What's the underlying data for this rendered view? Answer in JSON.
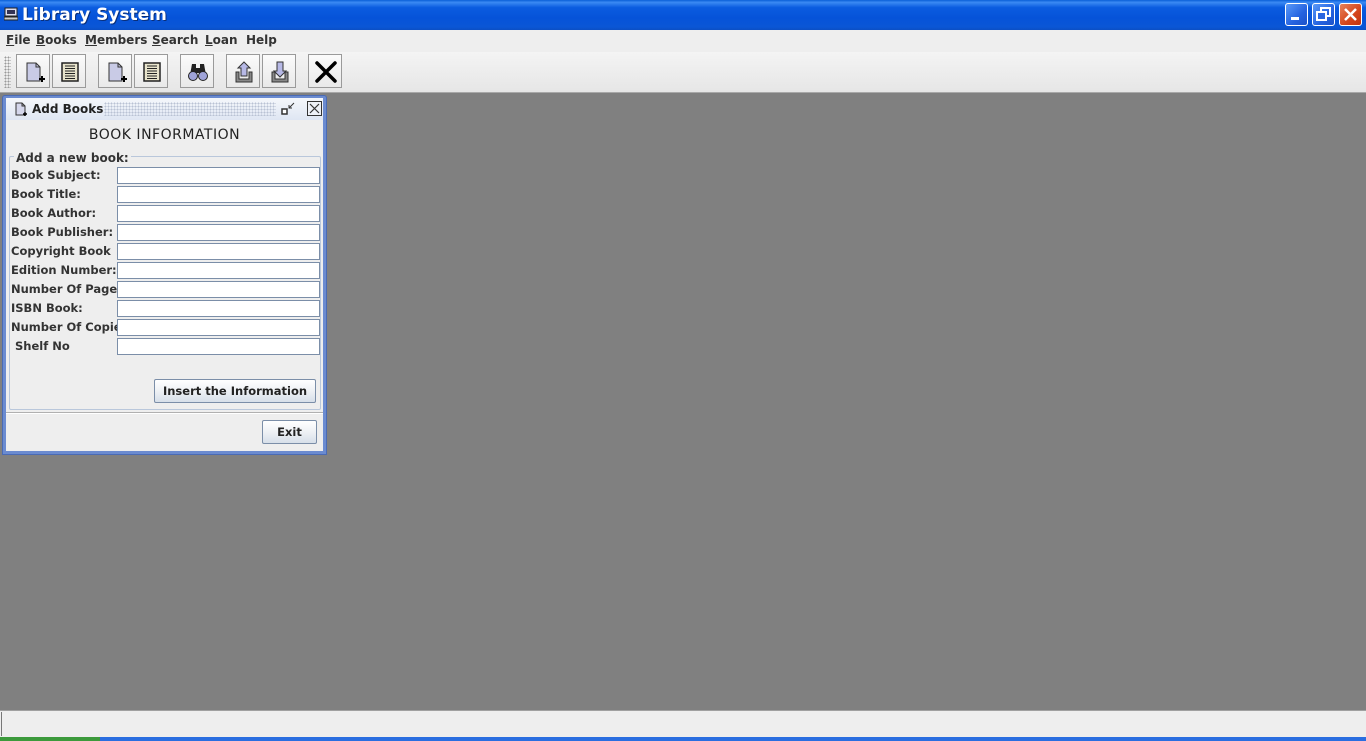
{
  "window": {
    "title": "Library System",
    "controls": {
      "minimize": "minimize",
      "restore": "restore",
      "close": "close"
    }
  },
  "menubar": {
    "items": [
      {
        "label": "File",
        "mnemonic": "F",
        "rest": "ile"
      },
      {
        "label": "Books",
        "mnemonic": "B",
        "rest": "ooks"
      },
      {
        "label": "Members",
        "mnemonic": "M",
        "rest": "embers"
      },
      {
        "label": "Search",
        "mnemonic": "S",
        "rest": "earch"
      },
      {
        "label": "Loan",
        "mnemonic": "L",
        "rest": "oan"
      },
      {
        "label": "Help",
        "mnemonic": "",
        "rest": "Help"
      }
    ]
  },
  "toolbar": {
    "buttons": [
      {
        "icon": "new-document-icon",
        "tooltip": "Add Books"
      },
      {
        "icon": "list-icon",
        "tooltip": "List Books"
      },
      {
        "icon": "new-document-icon",
        "tooltip": "Add Members"
      },
      {
        "icon": "list-icon",
        "tooltip": "List Members"
      },
      {
        "icon": "binoculars-icon",
        "tooltip": "Search"
      },
      {
        "icon": "upload-icon",
        "tooltip": "Borrow"
      },
      {
        "icon": "download-icon",
        "tooltip": "Return"
      },
      {
        "icon": "close-x-icon",
        "tooltip": "Exit"
      }
    ]
  },
  "add_books": {
    "title": "Add Books",
    "heading": "BOOK INFORMATION",
    "group_label": "Add a new book:",
    "fields": [
      {
        "label": "Book Subject:",
        "value": ""
      },
      {
        "label": "Book Title:",
        "value": ""
      },
      {
        "label": "Book Author:",
        "value": ""
      },
      {
        "label": "Book Publisher:",
        "value": ""
      },
      {
        "label": "Copyright Book",
        "value": ""
      },
      {
        "label": "Edition Number:",
        "value": ""
      },
      {
        "label": "Number Of Pages:",
        "value": ""
      },
      {
        "label": "ISBN Book:",
        "value": ""
      },
      {
        "label": "Number Of Copies:",
        "value": ""
      },
      {
        "label": " Shelf No",
        "value": ""
      }
    ],
    "insert_button": "Insert the Information",
    "exit_button": "Exit"
  },
  "statusbar": {
    "text": ""
  },
  "colors": {
    "titlebar": "#0653d9",
    "desktop": "#808080",
    "frame_border": "#6b8bd0",
    "panel": "#eeeeee"
  }
}
